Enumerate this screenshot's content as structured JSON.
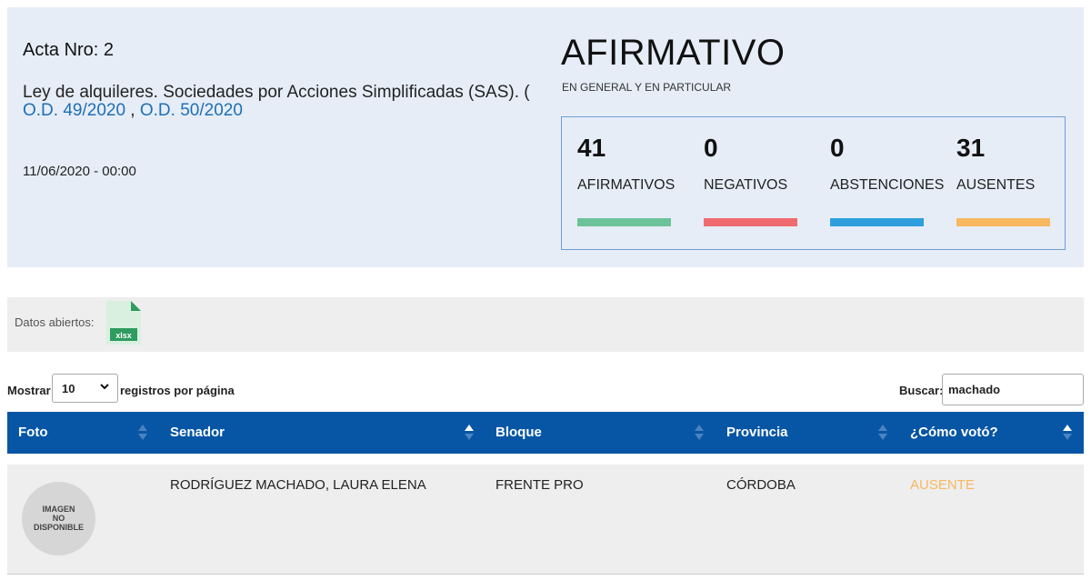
{
  "acta": {
    "title": "Acta Nro: 2",
    "law_text": "Ley de alquileres. Sociedades por Acciones Simplificadas (SAS). ( ",
    "link1": "O.D. 49/2020",
    "separator": " , ",
    "link2": "O.D. 50/2020",
    "date": "11/06/2020 - 00:00"
  },
  "result": {
    "title": "AFIRMATIVO",
    "subtitle": "EN GENERAL Y EN PARTICULAR",
    "stats": [
      {
        "value": "41",
        "label": "AFIRMATIVOS",
        "color": "#6cc39a"
      },
      {
        "value": "0",
        "label": "NEGATIVOS",
        "color": "#ef6b6f"
      },
      {
        "value": "0",
        "label": "ABSTENCIONES",
        "color": "#2e9fdc"
      },
      {
        "value": "31",
        "label": "AUSENTES",
        "color": "#f7b85f"
      }
    ]
  },
  "open_data": {
    "label": "Datos abiertos:",
    "file_type": "xlsx",
    "icon": "xlsx-file-icon"
  },
  "controls": {
    "show_label": "Mostrar",
    "per_page": "10",
    "per_page_suffix": "registros por página",
    "search_label": "Buscar:",
    "search_value": "machado"
  },
  "table": {
    "columns": [
      "Foto",
      "Senador",
      "Bloque",
      "Provincia",
      "¿Cómo votó?"
    ],
    "rows": [
      {
        "photo_line1": "IMAGEN",
        "photo_line2": "NO",
        "photo_line3": "DISPONIBLE",
        "senador": "RODRÍGUEZ MACHADO, LAURA ELENA",
        "bloque": "FRENTE PRO",
        "provincia": "CÓRDOBA",
        "voto": "AUSENTE",
        "voto_color": "#f7b85f"
      }
    ]
  }
}
